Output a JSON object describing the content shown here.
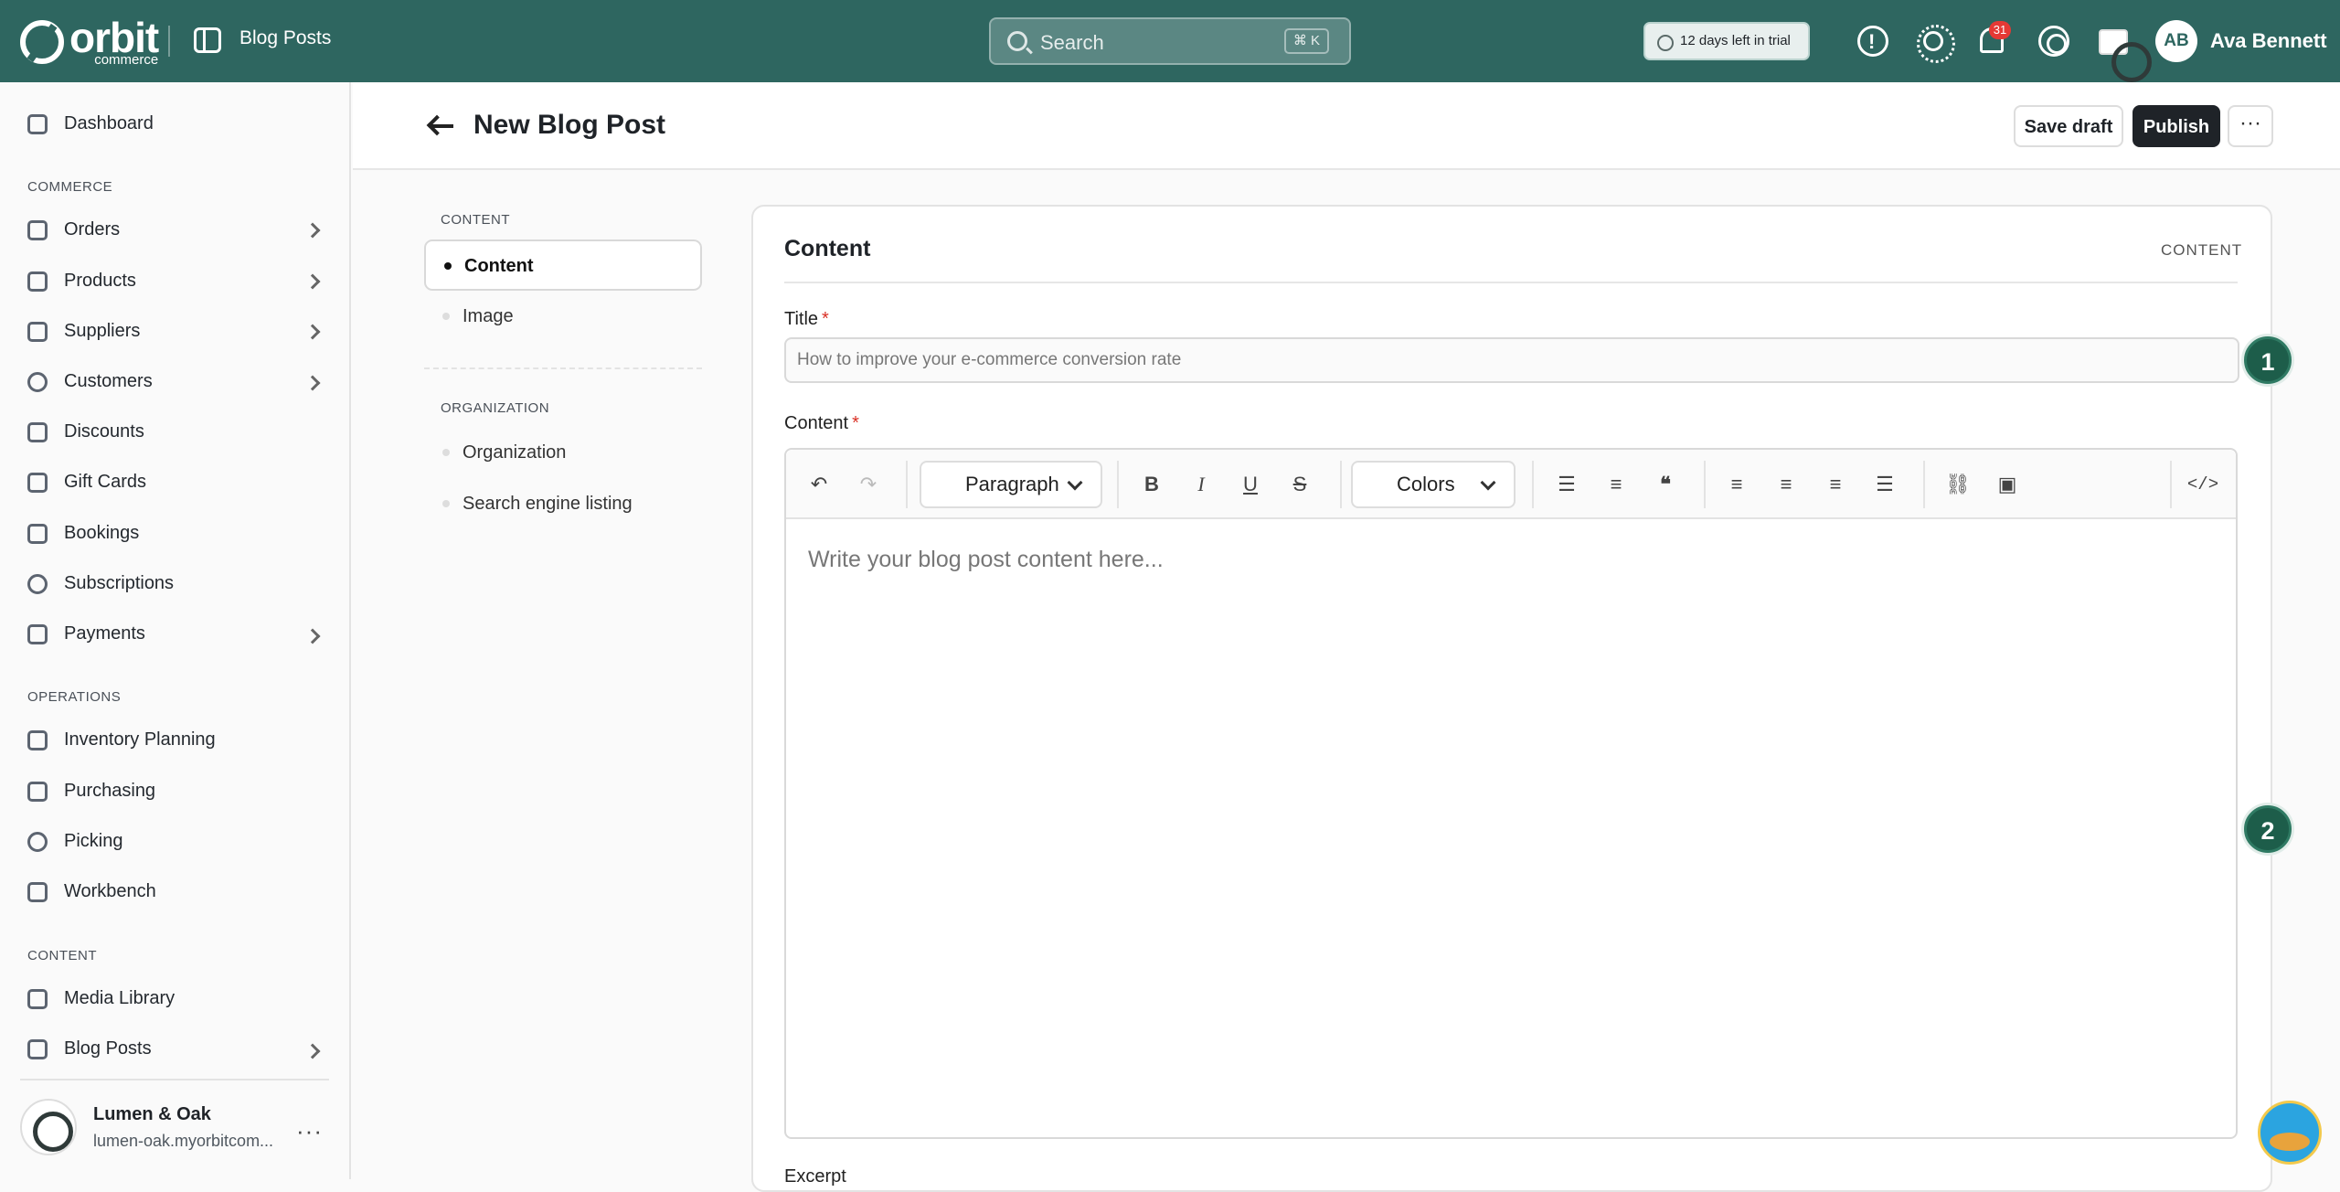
{
  "topbar": {
    "logo_word": "orbit",
    "logo_sub": "commerce",
    "breadcrumb": "Blog Posts",
    "search_placeholder": "Search",
    "search_shortcut": "⌘ K",
    "trial_text": "12 days left in trial",
    "notification_count": "31",
    "avatar_initials": "AB",
    "user_name": "Ava Bennett"
  },
  "sidebar": {
    "dashboard": "Dashboard",
    "sections": {
      "commerce": "COMMERCE",
      "operations": "OPERATIONS",
      "content": "CONTENT"
    },
    "commerce_items": [
      "Orders",
      "Products",
      "Suppliers",
      "Customers",
      "Discounts",
      "Gift Cards",
      "Bookings",
      "Subscriptions",
      "Payments"
    ],
    "operations_items": [
      "Inventory Planning",
      "Purchasing",
      "Picking",
      "Workbench"
    ],
    "content_items": [
      "Media Library",
      "Blog Posts"
    ],
    "store_name": "Lumen & Oak",
    "store_url": "lumen-oak.myorbitcom..."
  },
  "header": {
    "title": "New Blog Post",
    "save_draft": "Save draft",
    "publish": "Publish",
    "more": "···"
  },
  "toc": {
    "content_heading": "CONTENT",
    "content_items": [
      "Content",
      "Image"
    ],
    "organization_heading": "ORGANIZATION",
    "organization_items": [
      "Organization",
      "Search engine listing"
    ]
  },
  "card": {
    "title": "Content",
    "tag": "CONTENT",
    "title_label": "Title",
    "title_placeholder": "How to improve your e-commerce conversion rate",
    "content_label": "Content",
    "required_mark": "*",
    "paragraph_select": "Paragraph",
    "colors_select": "Colors",
    "editor_placeholder": "Write your blog post content here...",
    "excerpt_label": "Excerpt"
  },
  "steps": [
    "1",
    "2"
  ]
}
